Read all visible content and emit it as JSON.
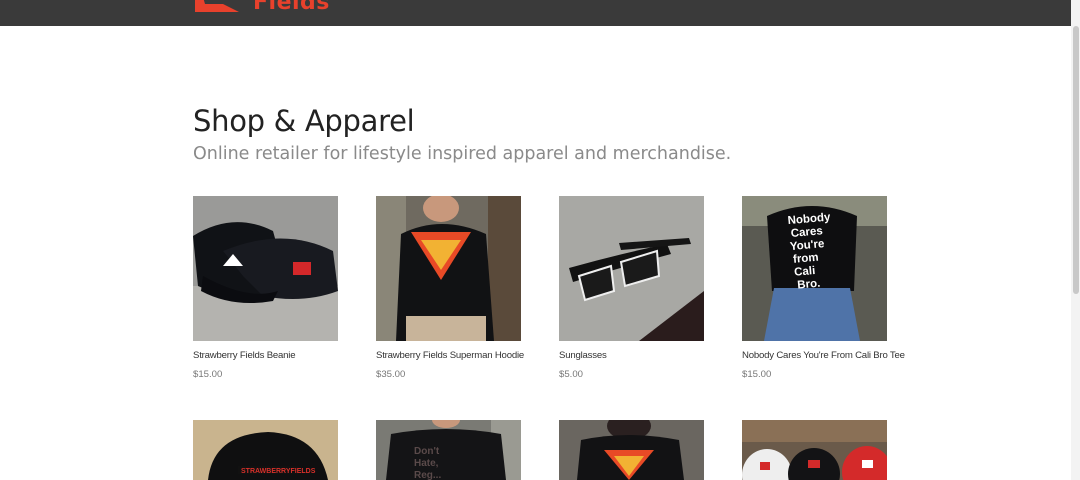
{
  "header": {
    "logo_text": "Fields",
    "colors": {
      "bar": "#3a3a3a",
      "brand": "#e8412c"
    }
  },
  "page": {
    "title": "Shop & Apparel",
    "subtitle": "Online retailer for lifestyle inspired apparel and merchandise."
  },
  "products_row1": [
    {
      "name": "Strawberry Fields Beanie",
      "price": "$15.00",
      "icon": "beanie-image"
    },
    {
      "name": "Strawberry Fields Superman Hoodie",
      "price": "$35.00",
      "icon": "hoodie-image"
    },
    {
      "name": "Sunglasses",
      "price": "$5.00",
      "icon": "sunglasses-image"
    },
    {
      "name": "Nobody Cares You're From Cali Bro Tee",
      "price": "$15.00",
      "icon": "tee-image"
    }
  ],
  "products_row2": [
    {
      "icon": "trucker-hat-image"
    },
    {
      "icon": "dont-hate-tee-image"
    },
    {
      "icon": "superman-tee-image"
    },
    {
      "icon": "hats-image"
    }
  ],
  "product_image_text": {
    "tee": [
      "Nobody",
      "Cares",
      "You're",
      "from",
      "Cali",
      "Bro."
    ],
    "trucker_hat": "STRAWBERRYFIELDS",
    "dont_hate_tee": [
      "Don't",
      "Hate,",
      "Reg..."
    ]
  }
}
